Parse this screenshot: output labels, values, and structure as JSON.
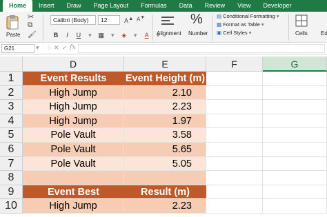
{
  "ribbon_tabs": [
    "Home",
    "Insert",
    "Draw",
    "Page Layout",
    "Formulas",
    "Data",
    "Review",
    "View",
    "Developer"
  ],
  "ribbon": {
    "paste_label": "Paste",
    "font_name": "Calibri (Body)",
    "font_size": "12",
    "bold": "B",
    "italic": "I",
    "underline": "U",
    "alignment_label": "Alignment",
    "number_label": "Number",
    "number_symbol": "%",
    "conditional_formatting": "Conditional Formatting",
    "format_as_table": "Format as Table",
    "cell_styles": "Cell Styles",
    "cells_label": "Cells",
    "editing_label": "Ed"
  },
  "formula_bar": {
    "name_box": "G21",
    "fx": "fx"
  },
  "columns": [
    "D",
    "E",
    "F",
    "G"
  ],
  "selected_column": "G",
  "rows": [
    {
      "num": "1",
      "d": "Event Results",
      "e": "Event Height (m)",
      "style": "hdr"
    },
    {
      "num": "2",
      "d": "High Jump",
      "e": "2.10",
      "style": "alt1"
    },
    {
      "num": "3",
      "d": "High Jump",
      "e": "2.23",
      "style": "alt2"
    },
    {
      "num": "4",
      "d": "High Jump",
      "e": "1.97",
      "style": "alt1"
    },
    {
      "num": "5",
      "d": "Pole Vault",
      "e": "3.58",
      "style": "alt2"
    },
    {
      "num": "6",
      "d": "Pole Vault",
      "e": "5.65",
      "style": "alt1"
    },
    {
      "num": "7",
      "d": "Pole Vault",
      "e": "5.05",
      "style": "alt2"
    },
    {
      "num": "8",
      "d": "",
      "e": "",
      "style": "alt1"
    },
    {
      "num": "9",
      "d": "Event Best",
      "e": "Result (m)",
      "style": "hdr"
    },
    {
      "num": "10",
      "d": "High Jump",
      "e": "2.23",
      "style": "alt1"
    }
  ],
  "colors": {
    "ribbon_green": "#1f7a45",
    "header_orange": "#c0592a",
    "band_dark": "#f6ccb5",
    "band_light": "#fbe5d9"
  }
}
